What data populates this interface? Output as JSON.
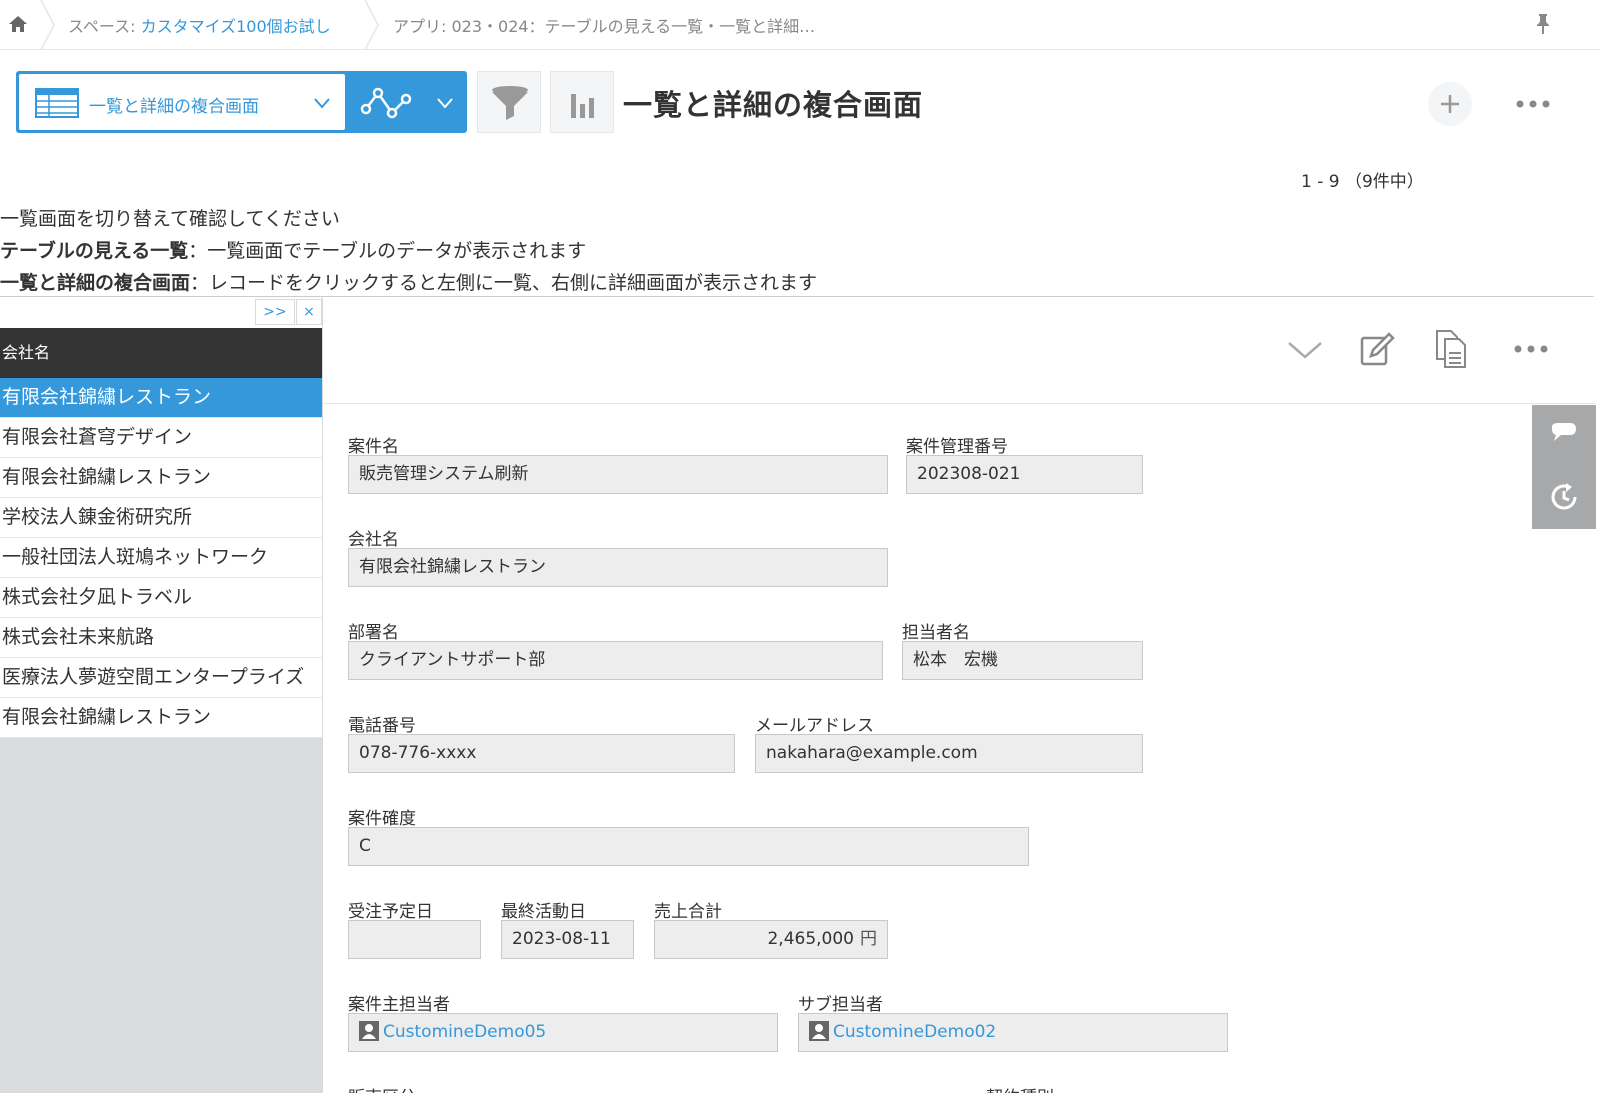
{
  "breadcrumb": {
    "space_prefix": "スペース: ",
    "space_name": "カスタマイズ100個お試し",
    "app_label": "アプリ: 023・024：テーブルの見える一覧・一覧と詳細…"
  },
  "toolbar": {
    "view_name": "一覧と詳細の複合画面",
    "title": "一覧と詳細の複合画面"
  },
  "pager": "1 - 9 （9件中）",
  "description": {
    "line1": "一覧画面を切り替えて確認してください",
    "line2_bold": "テーブルの見える一覧",
    "line2_rest": "：一覧画面でテーブルのデータが表示されます",
    "line3_bold": "一覧と詳細の複合画面",
    "line3_rest": "：レコードをクリックすると左側に一覧、右側に詳細画面が表示されます"
  },
  "list": {
    "expand_label": ">>",
    "close_label": "×",
    "header": "会社名",
    "rows": [
      "有限会社錦繍レストラン",
      "有限会社蒼穹デザイン",
      "有限会社錦繍レストラン",
      "学校法人錬金術研究所",
      "一般社団法人斑鳩ネットワーク",
      "株式会社夕凪トラベル",
      "株式会社未来航路",
      "医療法人夢遊空間エンタープライズ",
      "有限会社錦繍レストラン"
    ],
    "selected_index": 0
  },
  "record": {
    "project_name_label": "案件名",
    "project_name": "販売管理システム刷新",
    "project_no_label": "案件管理番号",
    "project_no": "202308-021",
    "company_label": "会社名",
    "company": "有限会社錦繍レストラン",
    "dept_label": "部署名",
    "dept": "クライアントサポート部",
    "person_label": "担当者名",
    "person": "松本　宏機",
    "phone_label": "電話番号",
    "phone": "078-776-xxxx",
    "email_label": "メールアドレス",
    "email": "nakahara@example.com",
    "certainty_label": "案件確度",
    "certainty": "C",
    "order_date_label": "受注予定日",
    "order_date": "",
    "last_activity_label": "最終活動日",
    "last_activity": "2023-08-11",
    "sales_total_label": "売上合計",
    "sales_total": "2,465,000",
    "sales_unit": "円",
    "main_owner_label": "案件主担当者",
    "main_owner": "CustomineDemo05",
    "sub_owner_label": "サブ担当者",
    "sub_owner": "CustomineDemo02",
    "sales_type_label": "販売区分",
    "contract_type_label": "契約種別"
  },
  "colors": {
    "accent": "#3498db",
    "header_dark": "#333333",
    "field_bg": "#ededed",
    "side_tab": "#a6a8a9"
  }
}
